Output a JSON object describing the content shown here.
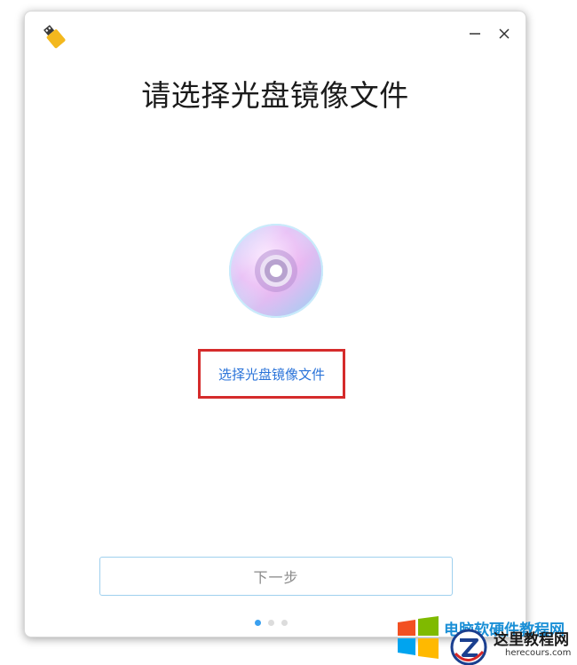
{
  "window": {
    "title": "请选择光盘镜像文件",
    "select_link_label": "选择光盘镜像文件",
    "next_button_label": "下一步",
    "controls": {
      "minimize_icon": "minimize-icon",
      "close_icon": "close-icon"
    },
    "app_icon": "usb-drive-icon",
    "disc_icon": "optical-disc-icon",
    "pagination": {
      "pages": 3,
      "current": 1
    }
  },
  "colors": {
    "link": "#2a73d9",
    "highlight_box": "#d52b2b",
    "next_border": "#9fd0ee",
    "dot_active": "#3aa0f0",
    "dot_inactive": "#dcdcdc"
  },
  "watermark": {
    "blue_text": "电脑软硬件教程网",
    "site_name": "这里教程网",
    "site_url": "herecours.com"
  }
}
